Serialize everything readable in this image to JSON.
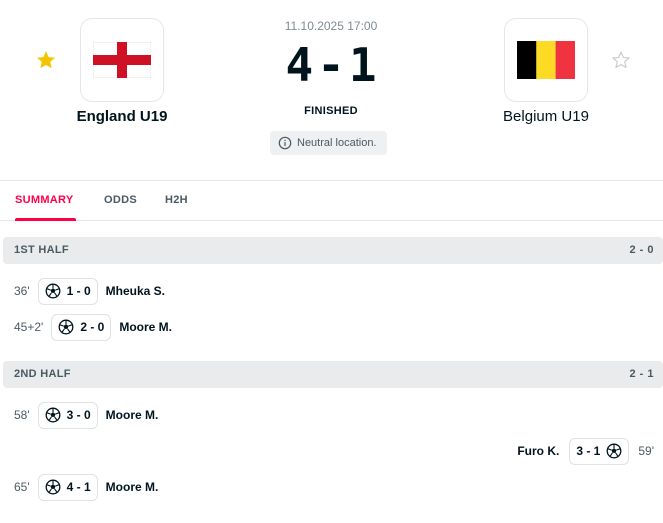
{
  "match": {
    "datetime": "11.10.2025 17:00",
    "home_score": "4",
    "score_separator": "-",
    "away_score": "1",
    "status": "FINISHED",
    "note": "Neutral location."
  },
  "home": {
    "name": "England U19",
    "favorite": true,
    "flag": "england-flag"
  },
  "away": {
    "name": "Belgium U19",
    "favorite": false,
    "flag": "belgium-flag"
  },
  "tabs": [
    {
      "label": "SUMMARY",
      "active": true
    },
    {
      "label": "ODDS",
      "active": false
    },
    {
      "label": "H2H",
      "active": false
    }
  ],
  "halves": [
    {
      "label": "1ST HALF",
      "score": "2 - 0"
    },
    {
      "label": "2ND HALF",
      "score": "2 - 1"
    }
  ],
  "events": [
    {
      "side": "home",
      "minute": "36'",
      "score": "1 - 0",
      "player": "Mheuka S.",
      "icon": "soccer-ball-icon"
    },
    {
      "side": "home",
      "minute": "45+2'",
      "score": "2 - 0",
      "player": "Moore M.",
      "icon": "soccer-ball-icon"
    },
    {
      "side": "home",
      "minute": "58'",
      "score": "3 - 0",
      "player": "Moore M.",
      "icon": "soccer-ball-icon"
    },
    {
      "side": "away",
      "minute": "59'",
      "score": "3 - 1",
      "player": "Furo K.",
      "icon": "soccer-ball-icon"
    },
    {
      "side": "home",
      "minute": "65'",
      "score": "4 - 1",
      "player": "Moore M.",
      "icon": "soccer-ball-icon"
    }
  ],
  "colors": {
    "accent": "#ff0046",
    "star_active": "#f2c500",
    "star_inactive": "#c8cdd0",
    "england_red": "#ce1124",
    "belgium_black": "#000000",
    "belgium_yellow": "#fdda24",
    "belgium_red": "#ef3340"
  }
}
